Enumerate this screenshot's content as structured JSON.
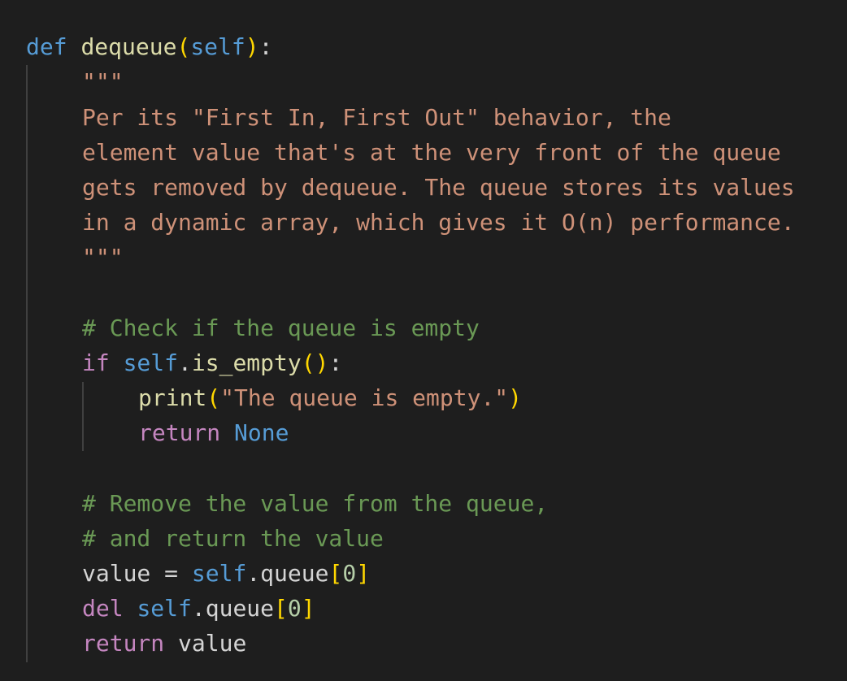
{
  "code": {
    "l1": {
      "kw": "def",
      "name": "dequeue",
      "open": "(",
      "param": "self",
      "close": ")",
      "colon": ":"
    },
    "l2": {
      "doc": "\"\"\""
    },
    "l3": {
      "doc": "Per its \"First In, First Out\" behavior, the"
    },
    "l4": {
      "doc": "element value that's at the very front of the queue"
    },
    "l5": {
      "doc": "gets removed by dequeue. The queue stores its values"
    },
    "l6": {
      "doc": "in a dynamic array, which gives it O(n) performance."
    },
    "l7": {
      "doc": "\"\"\""
    },
    "l8": {
      "comment": "# Check if the queue is empty"
    },
    "l9": {
      "kw": "if",
      "self": "self",
      "dot": ".",
      "method": "is_empty",
      "parens": "()",
      "colon": ":"
    },
    "l10": {
      "fn": "print",
      "open": "(",
      "str": "\"The queue is empty.\"",
      "close": ")"
    },
    "l11": {
      "kw": "return",
      "val": "None"
    },
    "l12": {
      "comment": "# Remove the value from the queue,"
    },
    "l13": {
      "comment": "# and return the value"
    },
    "l14": {
      "var": "value",
      "eq": " = ",
      "self": "self",
      "dot": ".",
      "attr": "queue",
      "open": "[",
      "idx": "0",
      "close": "]"
    },
    "l15": {
      "kw": "del",
      "self": "self",
      "dot": ".",
      "attr": "queue",
      "open": "[",
      "idx": "0",
      "close": "]"
    },
    "l16": {
      "kw": "return",
      "var": "value"
    }
  }
}
